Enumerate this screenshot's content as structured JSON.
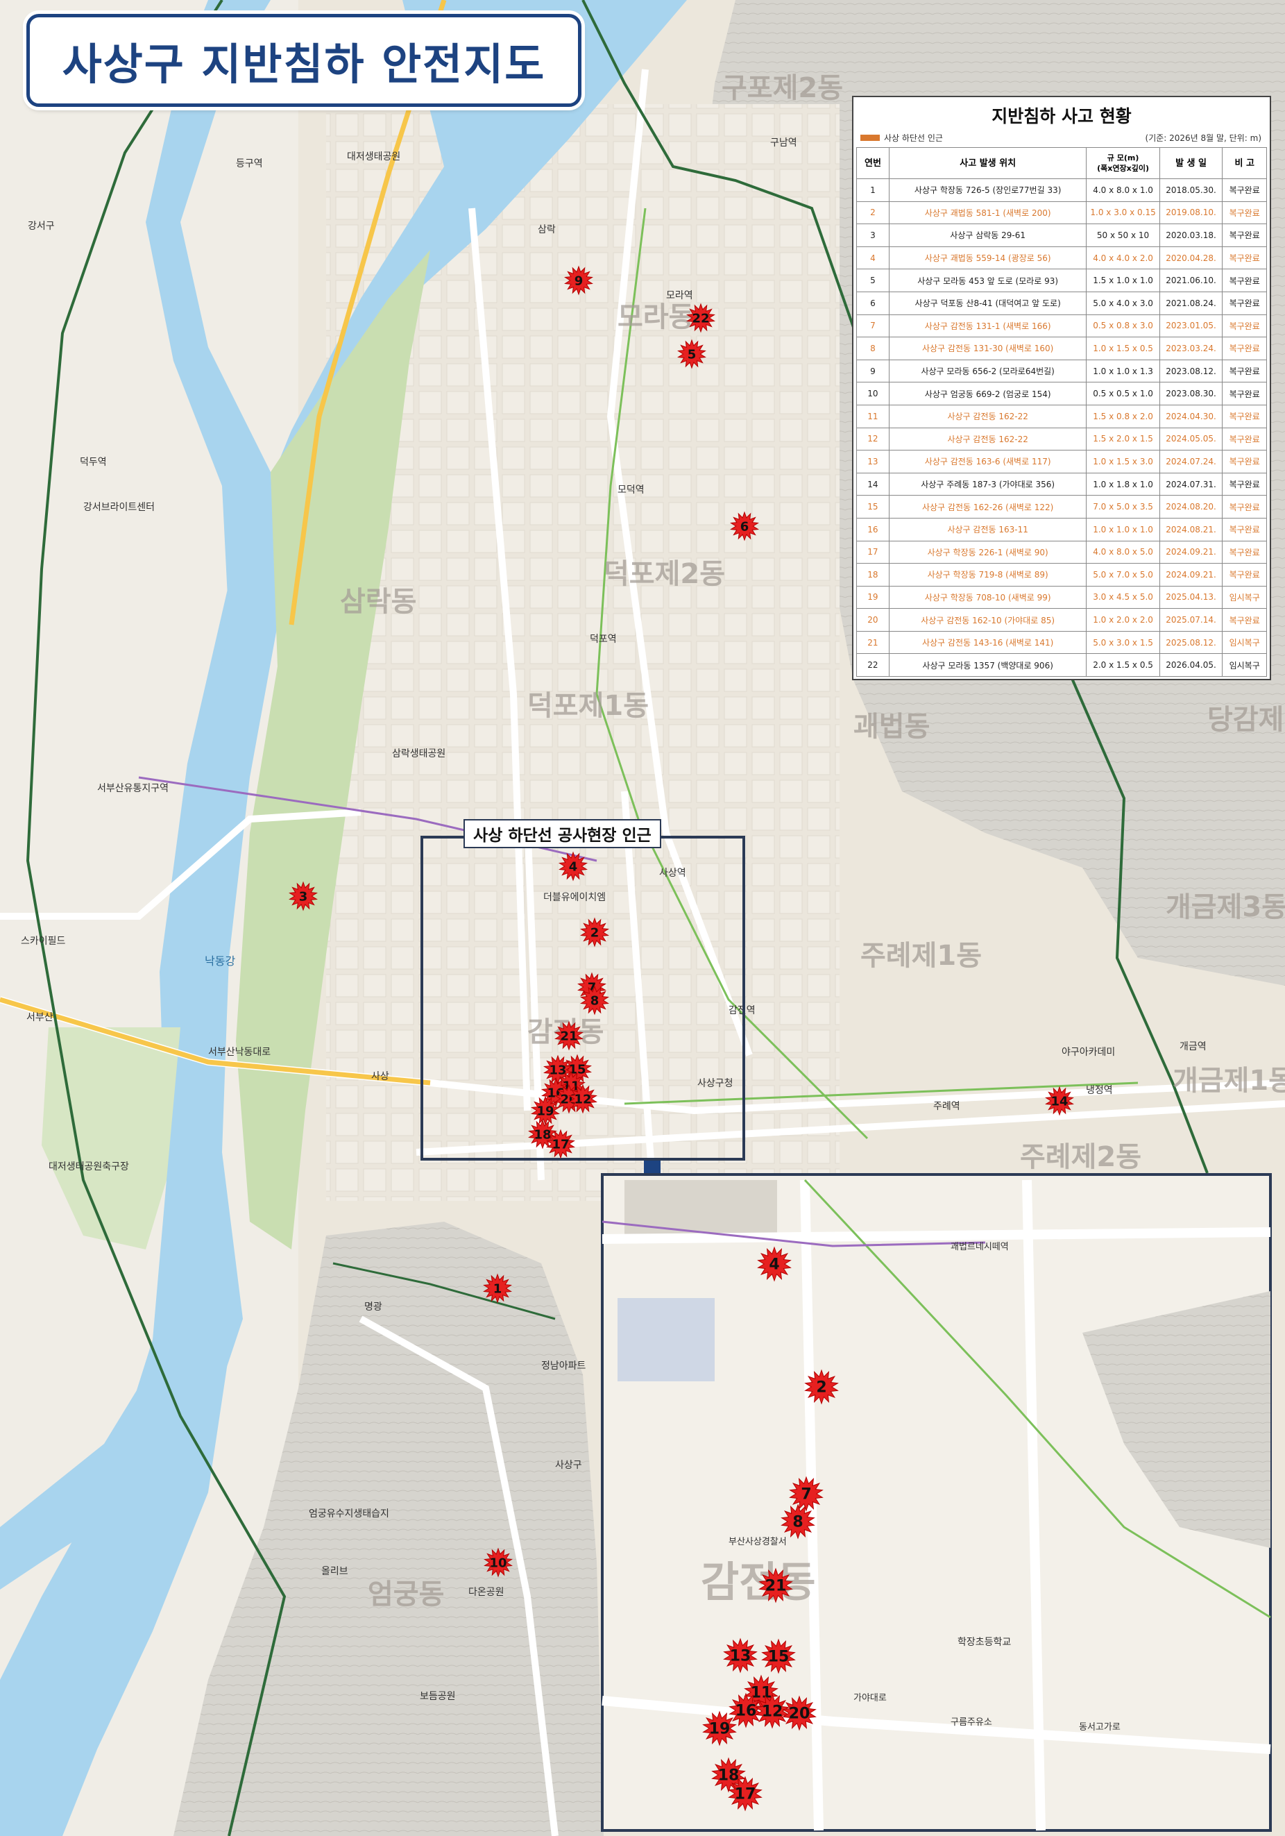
{
  "title": "사상구 지반침하 안전지도",
  "table": {
    "title": "지반침하 사고 현황",
    "legend": "사상 하단선 인근",
    "basis": "(기준: 2026년 8월 말, 단위: m)",
    "headers": [
      "연번",
      "사고 발생 위치",
      "규 모(m)\n(폭x연장x깊이)",
      "발 생 일",
      "비 고"
    ],
    "rows": [
      {
        "no": "1",
        "loc": "사상구 학장동 726-5 (장인로77번길 33)",
        "size": "4.0 x 8.0 x 1.0",
        "date": "2018.05.30.",
        "note": "복구완료",
        "hl": false
      },
      {
        "no": "2",
        "loc": "사상구 괘법동 581-1 (새벽로 200)",
        "size": "1.0 x 3.0 x 0.15",
        "date": "2019.08.10.",
        "note": "복구완료",
        "hl": true
      },
      {
        "no": "3",
        "loc": "사상구 삼락동 29-61",
        "size": "50 x 50 x 10",
        "date": "2020.03.18.",
        "note": "복구완료",
        "hl": false
      },
      {
        "no": "4",
        "loc": "사상구 괘법동 559-14 (광장로 56)",
        "size": "4.0 x 4.0 x 2.0",
        "date": "2020.04.28.",
        "note": "복구완료",
        "hl": true
      },
      {
        "no": "5",
        "loc": "사상구 모라동 453 앞 도로 (모라로 93)",
        "size": "1.5 x 1.0 x 1.0",
        "date": "2021.06.10.",
        "note": "복구완료",
        "hl": false
      },
      {
        "no": "6",
        "loc": "사상구 덕포동 산8-41 (대덕여고 앞 도로)",
        "size": "5.0 x 4.0 x 3.0",
        "date": "2021.08.24.",
        "note": "복구완료",
        "hl": false
      },
      {
        "no": "7",
        "loc": "사상구 감전동 131-1 (새벽로 166)",
        "size": "0.5 x 0.8 x 3.0",
        "date": "2023.01.05.",
        "note": "복구완료",
        "hl": true
      },
      {
        "no": "8",
        "loc": "사상구 감전동 131-30 (새벽로 160)",
        "size": "1.0 x 1.5 x 0.5",
        "date": "2023.03.24.",
        "note": "복구완료",
        "hl": true
      },
      {
        "no": "9",
        "loc": "사상구 모라동 656-2 (모라로64번길)",
        "size": "1.0 x 1.0 x 1.3",
        "date": "2023.08.12.",
        "note": "복구완료",
        "hl": false
      },
      {
        "no": "10",
        "loc": "사상구 엄궁동 669-2 (엄궁로 154)",
        "size": "0.5 x 0.5 x 1.0",
        "date": "2023.08.30.",
        "note": "복구완료",
        "hl": false
      },
      {
        "no": "11",
        "loc": "사상구 감전동 162-22",
        "size": "1.5 x 0.8 x 2.0",
        "date": "2024.04.30.",
        "note": "복구완료",
        "hl": true
      },
      {
        "no": "12",
        "loc": "사상구 감전동 162-22",
        "size": "1.5 x 2.0 x 1.5",
        "date": "2024.05.05.",
        "note": "복구완료",
        "hl": true
      },
      {
        "no": "13",
        "loc": "사상구 감전동 163-6 (새벽로 117)",
        "size": "1.0 x 1.5 x 3.0",
        "date": "2024.07.24.",
        "note": "복구완료",
        "hl": true
      },
      {
        "no": "14",
        "loc": "사상구 주례동 187-3 (가야대로 356)",
        "size": "1.0 x 1.8 x 1.0",
        "date": "2024.07.31.",
        "note": "복구완료",
        "hl": false
      },
      {
        "no": "15",
        "loc": "사상구 감전동 162-26 (새벽로 122)",
        "size": "7.0 x 5.0 x 3.5",
        "date": "2024.08.20.",
        "note": "복구완료",
        "hl": true
      },
      {
        "no": "16",
        "loc": "사상구 감전동 163-11",
        "size": "1.0 x 1.0 x 1.0",
        "date": "2024.08.21.",
        "note": "복구완료",
        "hl": true
      },
      {
        "no": "17",
        "loc": "사상구 학장동 226-1 (새벽로 90)",
        "size": "4.0 x 8.0 x 5.0",
        "date": "2024.09.21.",
        "note": "복구완료",
        "hl": true
      },
      {
        "no": "18",
        "loc": "사상구 학장동 719-8 (새벽로 89)",
        "size": "5.0 x 7.0 x 5.0",
        "date": "2024.09.21.",
        "note": "복구완료",
        "hl": true
      },
      {
        "no": "19",
        "loc": "사상구 학장동 708-10 (새벽로 99)",
        "size": "3.0 x 4.5 x 5.0",
        "date": "2025.04.13.",
        "note": "임시복구",
        "hl": true
      },
      {
        "no": "20",
        "loc": "사상구 감전동 162-10 (가야대로 85)",
        "size": "1.0 x 2.0 x 2.0",
        "date": "2025.07.14.",
        "note": "복구완료",
        "hl": true
      },
      {
        "no": "21",
        "loc": "사상구 감전동 143-16 (새벽로 141)",
        "size": "5.0 x 3.0 x 1.5",
        "date": "2025.08.12.",
        "note": "임시복구",
        "hl": true
      },
      {
        "no": "22",
        "loc": "사상구 모라동 1357 (백양대로 906)",
        "size": "2.0 x 1.5 x 0.5",
        "date": "2026.04.05.",
        "note": "임시복구",
        "hl": false
      }
    ]
  },
  "inset_label": "사상 하단선 공사현장 인근",
  "district_labels": [
    "구포제2동",
    "모라동",
    "덕포제2동",
    "덕포제1동",
    "삼락동",
    "괘법동",
    "주례제1동",
    "주례제2동",
    "감전동",
    "엄궁동",
    "개금제3동",
    "개금제1동",
    "당감제",
    "감전동"
  ],
  "place_labels": [
    "강서구",
    "대저생태공원",
    "삼락생태공원",
    "덕두역",
    "강서브라이트센터",
    "서부산유통지구역",
    "스카이필드",
    "서부산",
    "사상",
    "덕포역",
    "모라역",
    "모덕역",
    "사상역",
    "괘법르네시떼역",
    "감전역",
    "주례역",
    "냉정역",
    "구남역",
    "삼락",
    "등구역",
    "대저생태공원축구장",
    "정남아파트",
    "명광",
    "엄궁유수지생태습지",
    "다온공원",
    "보듬공원",
    "올리브",
    "사상구청",
    "더블유에이치엠",
    "개금역",
    "사상구",
    "학장초등학교",
    "부산사상경찰서",
    "구름주유소",
    "야구아카데미",
    "동서고가로",
    "가야대로",
    "낙동강",
    "서부산낙동대로",
    "1",
    "3",
    "10",
    "14"
  ],
  "markers_main": [
    "9",
    "22",
    "5",
    "6",
    "3",
    "4",
    "2",
    "7",
    "8",
    "21",
    "15",
    "13",
    "11",
    "16",
    "20",
    "12",
    "19",
    "18",
    "17",
    "1",
    "10",
    "14"
  ],
  "markers_inset": [
    "4",
    "2",
    "7",
    "8",
    "21",
    "13",
    "15",
    "11",
    "16",
    "12",
    "20",
    "19",
    "18",
    "17"
  ],
  "colors": {
    "title": "#1d4381",
    "marker": "#e62020",
    "river": "#a8d4ee",
    "road": "#ffffff",
    "park": "#c9deb1",
    "boundary": "#2e6b3a",
    "highlight": "#d9782e"
  }
}
